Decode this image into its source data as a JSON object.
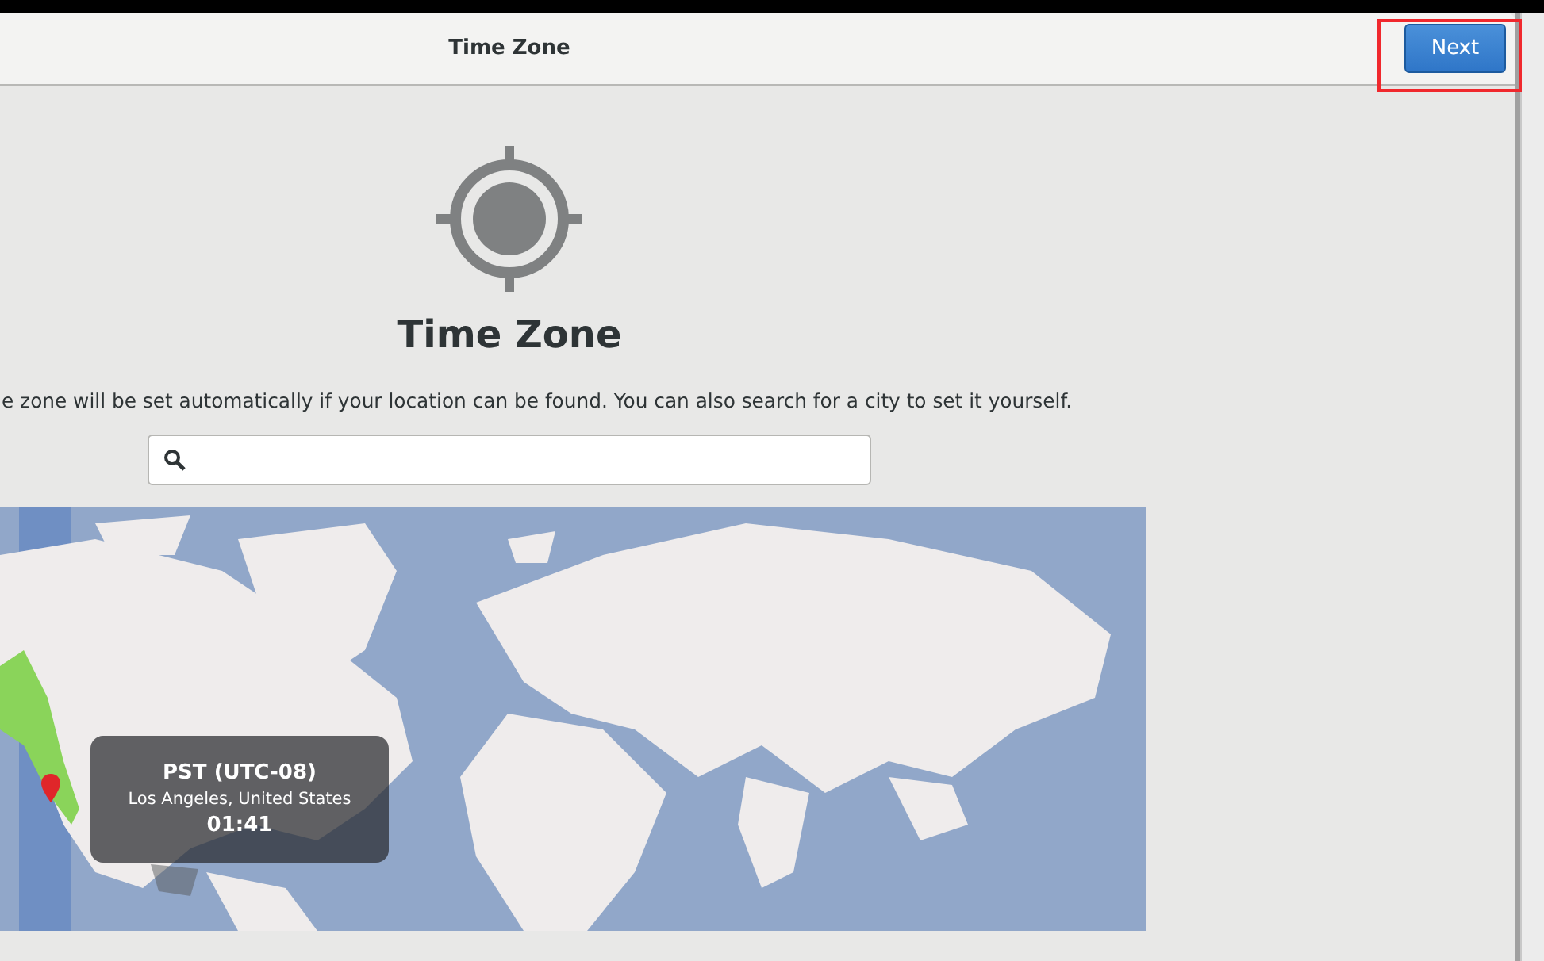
{
  "header": {
    "title": "Time Zone",
    "next_button": "Next"
  },
  "heading": "Time Zone",
  "description": "e zone will be set automatically if your location can be found. You can also search for a city to set it yourself.",
  "map": {
    "tooltip": {
      "zone": "PST (UTC-08)",
      "city": "Los Angeles, United States",
      "time": "01:41"
    }
  }
}
